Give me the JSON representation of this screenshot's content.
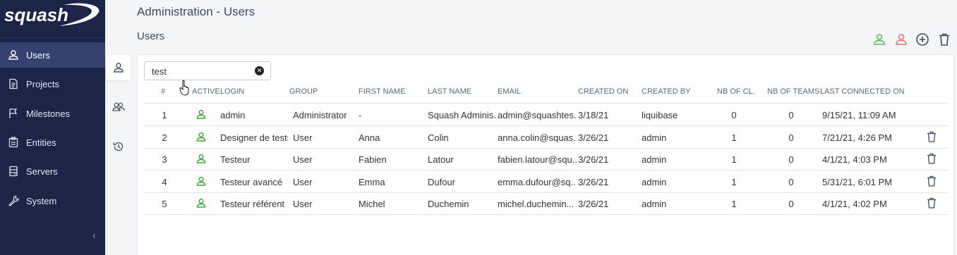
{
  "app": {
    "logo_text": "squash"
  },
  "sidebar": {
    "items": [
      {
        "label": "Users",
        "icon": "user-icon",
        "active": true
      },
      {
        "label": "Projects",
        "icon": "document-icon",
        "active": false
      },
      {
        "label": "Milestones",
        "icon": "flag-icon",
        "active": false
      },
      {
        "label": "Entities",
        "icon": "clipboard-icon",
        "active": false
      },
      {
        "label": "Servers",
        "icon": "server-icon",
        "active": false
      },
      {
        "label": "System",
        "icon": "wrench-icon",
        "active": false
      }
    ],
    "collapse_glyph": "‹"
  },
  "header": {
    "title": "Administration - Users",
    "section": "Users"
  },
  "toolbar": {
    "icons": [
      "activate-user-icon",
      "deactivate-user-icon",
      "add-circle-icon",
      "delete-icon"
    ],
    "colors": {
      "activate": "#5cb85c",
      "deactivate": "#e57373",
      "neutral": "#4a5568"
    }
  },
  "side_tabs": [
    "user-icon",
    "team-icon",
    "history-icon"
  ],
  "search": {
    "value": "test"
  },
  "table": {
    "columns": [
      "#",
      "ACTIVE",
      "LOGIN",
      "GROUP",
      "FIRST NAME",
      "LAST NAME",
      "EMAIL",
      "CREATED ON",
      "CREATED BY",
      "NB OF CL.",
      "NB OF TEAMS",
      "LAST CONNECTED ON"
    ],
    "rows": [
      {
        "num": "1",
        "login": "admin",
        "group": "Administrator",
        "first": "-",
        "last": "Squash Adminis...",
        "email": "admin@squashtes...",
        "created_on": "3/18/21",
        "created_by": "liquibase",
        "nb_cl": "0",
        "nb_teams": "0",
        "last_conn": "9/15/21, 11:09 AM",
        "deletable": false
      },
      {
        "num": "2",
        "login": "Designer de tests",
        "group": "User",
        "first": "Anna",
        "last": "Colin",
        "email": "anna.colin@squas...",
        "created_on": "3/26/21",
        "created_by": "admin",
        "nb_cl": "1",
        "nb_teams": "0",
        "last_conn": "7/21/21, 4:26 PM",
        "deletable": true
      },
      {
        "num": "3",
        "login": "Testeur",
        "group": "User",
        "first": "Fabien",
        "last": "Latour",
        "email": "fabien.latour@squ...",
        "created_on": "3/26/21",
        "created_by": "admin",
        "nb_cl": "1",
        "nb_teams": "0",
        "last_conn": "4/1/21, 4:03 PM",
        "deletable": true
      },
      {
        "num": "4",
        "login": "Testeur avancé",
        "group": "User",
        "first": "Emma",
        "last": "Dufour",
        "email": "emma.dufour@sq...",
        "created_on": "3/26/21",
        "created_by": "admin",
        "nb_cl": "1",
        "nb_teams": "0",
        "last_conn": "5/31/21, 6:01 PM",
        "deletable": true
      },
      {
        "num": "5",
        "login": "Testeur référent",
        "group": "User",
        "first": "Michel",
        "last": "Duchemin",
        "email": "michel.duchemin...",
        "created_on": "3/26/21",
        "created_by": "admin",
        "nb_cl": "1",
        "nb_teams": "0",
        "last_conn": "4/1/21, 4:02 PM",
        "deletable": true
      }
    ]
  }
}
